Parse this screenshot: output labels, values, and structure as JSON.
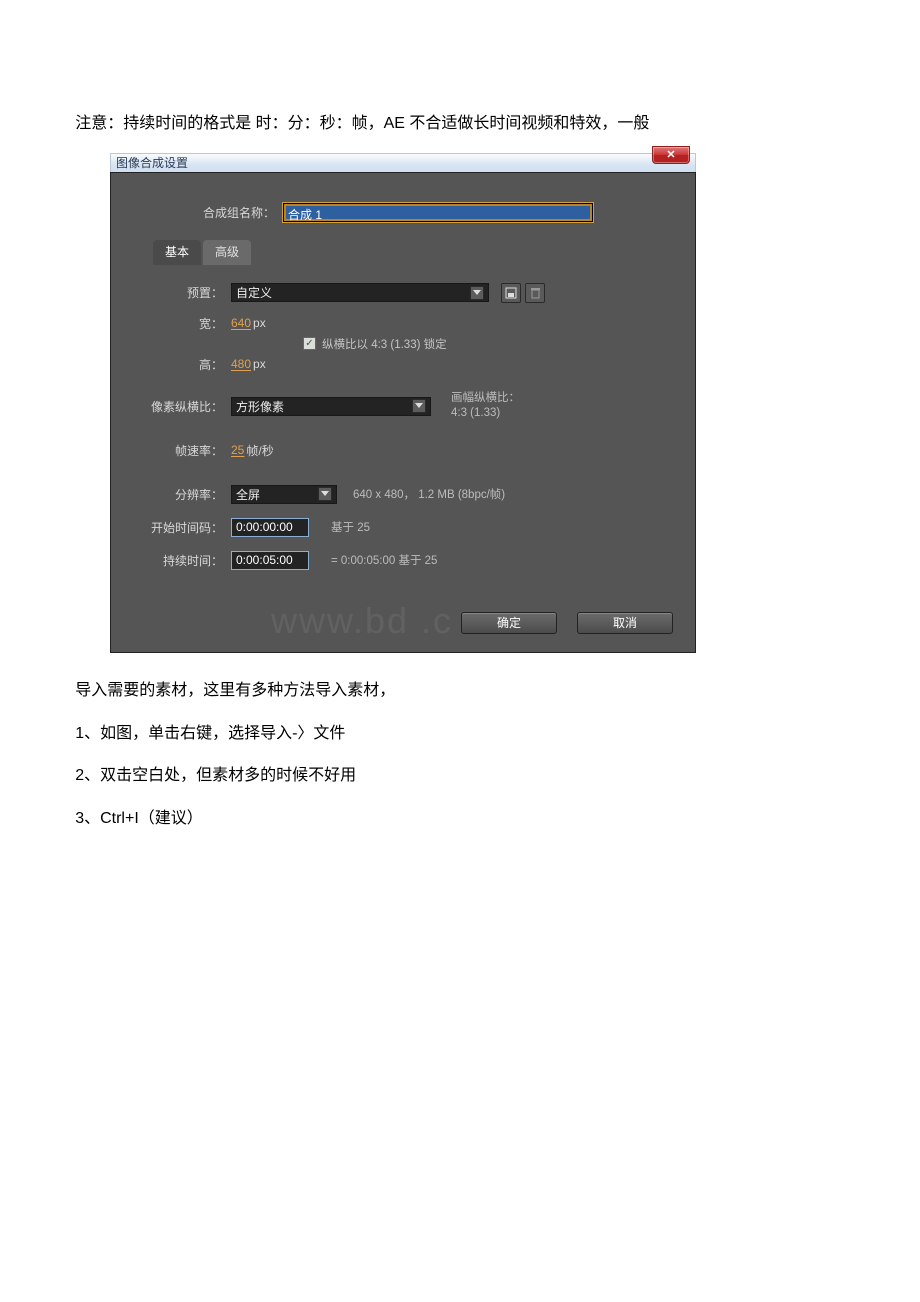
{
  "doc": {
    "intro": "注意：持续时间的格式是 时：分：秒：帧，AE 不合适做长时间视频和特效，一般",
    "p1": "导入需要的素材，这里有多种方法导入素材，",
    "p2": "1、如图，单击右键，选择导入-〉文件",
    "p3": "2、双击空白处，但素材多的时候不好用",
    "p4": "3、Ctrl+I（建议）"
  },
  "titlebar": {
    "title": "图像合成设置",
    "close": "✕"
  },
  "dialog": {
    "comp_name_label": "合成组名称：",
    "comp_name_value": "合成 1",
    "tabs": {
      "basic": "基本",
      "advanced": "高级"
    },
    "preset_label": "预置：",
    "preset_value": "自定义",
    "width_label": "宽：",
    "width_value": "640",
    "width_unit": "px",
    "height_label": "高：",
    "height_value": "480",
    "height_unit": "px",
    "lock_aspect_label": "纵横比以 4:3 (1.33) 锁定",
    "par_label": "像素纵横比：",
    "par_value": "方形像素",
    "par_side_label": "画幅纵横比：",
    "par_side_value": "4:3 (1.33)",
    "fps_label": "帧速率：",
    "fps_value": "25",
    "fps_unit": "帧/秒",
    "res_label": "分辨率：",
    "res_value": "全屏",
    "res_info": "640 x 480， 1.2 MB (8bpc/帧)",
    "start_tc_label": "开始时间码：",
    "start_tc_value": "0:00:00:00",
    "start_tc_note": "基于 25",
    "dur_label": "持续时间：",
    "dur_value": "0:00:05:00",
    "dur_note": "= 0:00:05:00 基于 25",
    "ok": "确定",
    "cancel": "取消"
  },
  "watermark": "www.bd   .c   "
}
